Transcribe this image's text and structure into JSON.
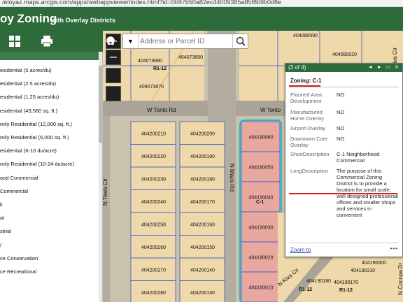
{
  "browser": {
    "url": "/eloyaz.maps.arcgis.com/apps/webappviewer/index.html?id=0b97b50a82ec44009385a85f8b9b0d8e"
  },
  "header": {
    "title": "oy Zoning",
    "subtitle": "with Overlay Districts",
    "bg": "#2e6b3a"
  },
  "toolbar": {
    "icons": [
      "grid-icon",
      "print-icon"
    ]
  },
  "legend": {
    "items": [
      "esidential (5 acres/du)",
      "esidential (2.5 acres/du)",
      "esidential (1.25 acres/du)",
      "esidential (43,560 sq. ft.)",
      "mily Residential (12,000 sq. ft.)",
      "mily Residential (6,000 sq. ft.)",
      "esidential (6-10 du/acre)",
      "mily Residential (10-24 du/acre)",
      "ood Commercial",
      "Commercial",
      "k",
      "al",
      "strial",
      "/",
      "ce Conservation",
      "ce Recreational"
    ]
  },
  "search": {
    "placeholder": "Address or Parcel ID",
    "dropdown": "▼"
  },
  "map": {
    "roads": [
      "W Tonto Rd",
      "W Tonto",
      "N Tewa Cir",
      "N Maya Rd",
      "N Kiva Cir",
      "N Kiva Cir",
      "N Cocopa Dr"
    ],
    "parcels_left_block": [
      "404200210",
      "404200220",
      "404200230",
      "404200240",
      "404200250",
      "404200260",
      "404200270",
      "404200280"
    ],
    "parcels_mid_block": [
      "404200200",
      "404200190",
      "404200180",
      "404200170",
      "404200160",
      "404200150",
      "404200140",
      "404200130"
    ],
    "parcels_c1": [
      "404190060",
      "404190050",
      "404190040",
      "404190030",
      "404190020",
      "404190010"
    ],
    "parcels_top": [
      "404073680",
      "404073660",
      "404073670",
      "404080020",
      "404080010",
      "404080090"
    ],
    "parcels_bottom_right": [
      "404190100",
      "404190110",
      "404190300",
      "404190310",
      "404190180",
      "404190170"
    ],
    "zone_labels": [
      "R1-12",
      "C-1",
      "R1-12",
      "R1-12"
    ],
    "colors": {
      "parcel": "#f2cf95",
      "c1": "#e8a8a0",
      "road": "#a9a497",
      "highlight": "#22b8c9"
    }
  },
  "popup": {
    "counter": "(3 of 4)",
    "nav": "◄ ► ▭ ✕",
    "title": "Zoning: C-1",
    "attributes": [
      {
        "key": "Planned Area Development",
        "value": "NO"
      },
      {
        "key": "Manufactured Home Overlay",
        "value": "NO"
      },
      {
        "key": "Airport Overlay",
        "value": "NO"
      },
      {
        "key": "Downtown Core Overlay",
        "value": "NO"
      },
      {
        "key": "ShortDescription",
        "value": "C-1 Neighborhood Commercial"
      },
      {
        "key": "LongDescription",
        "value": "The purpose of this Commercial Zoning District is to provide a location for small scale, well designed professional offices and smaller shops and services in convenient"
      }
    ],
    "zoom_link": "Zoom to",
    "more": "•••"
  }
}
